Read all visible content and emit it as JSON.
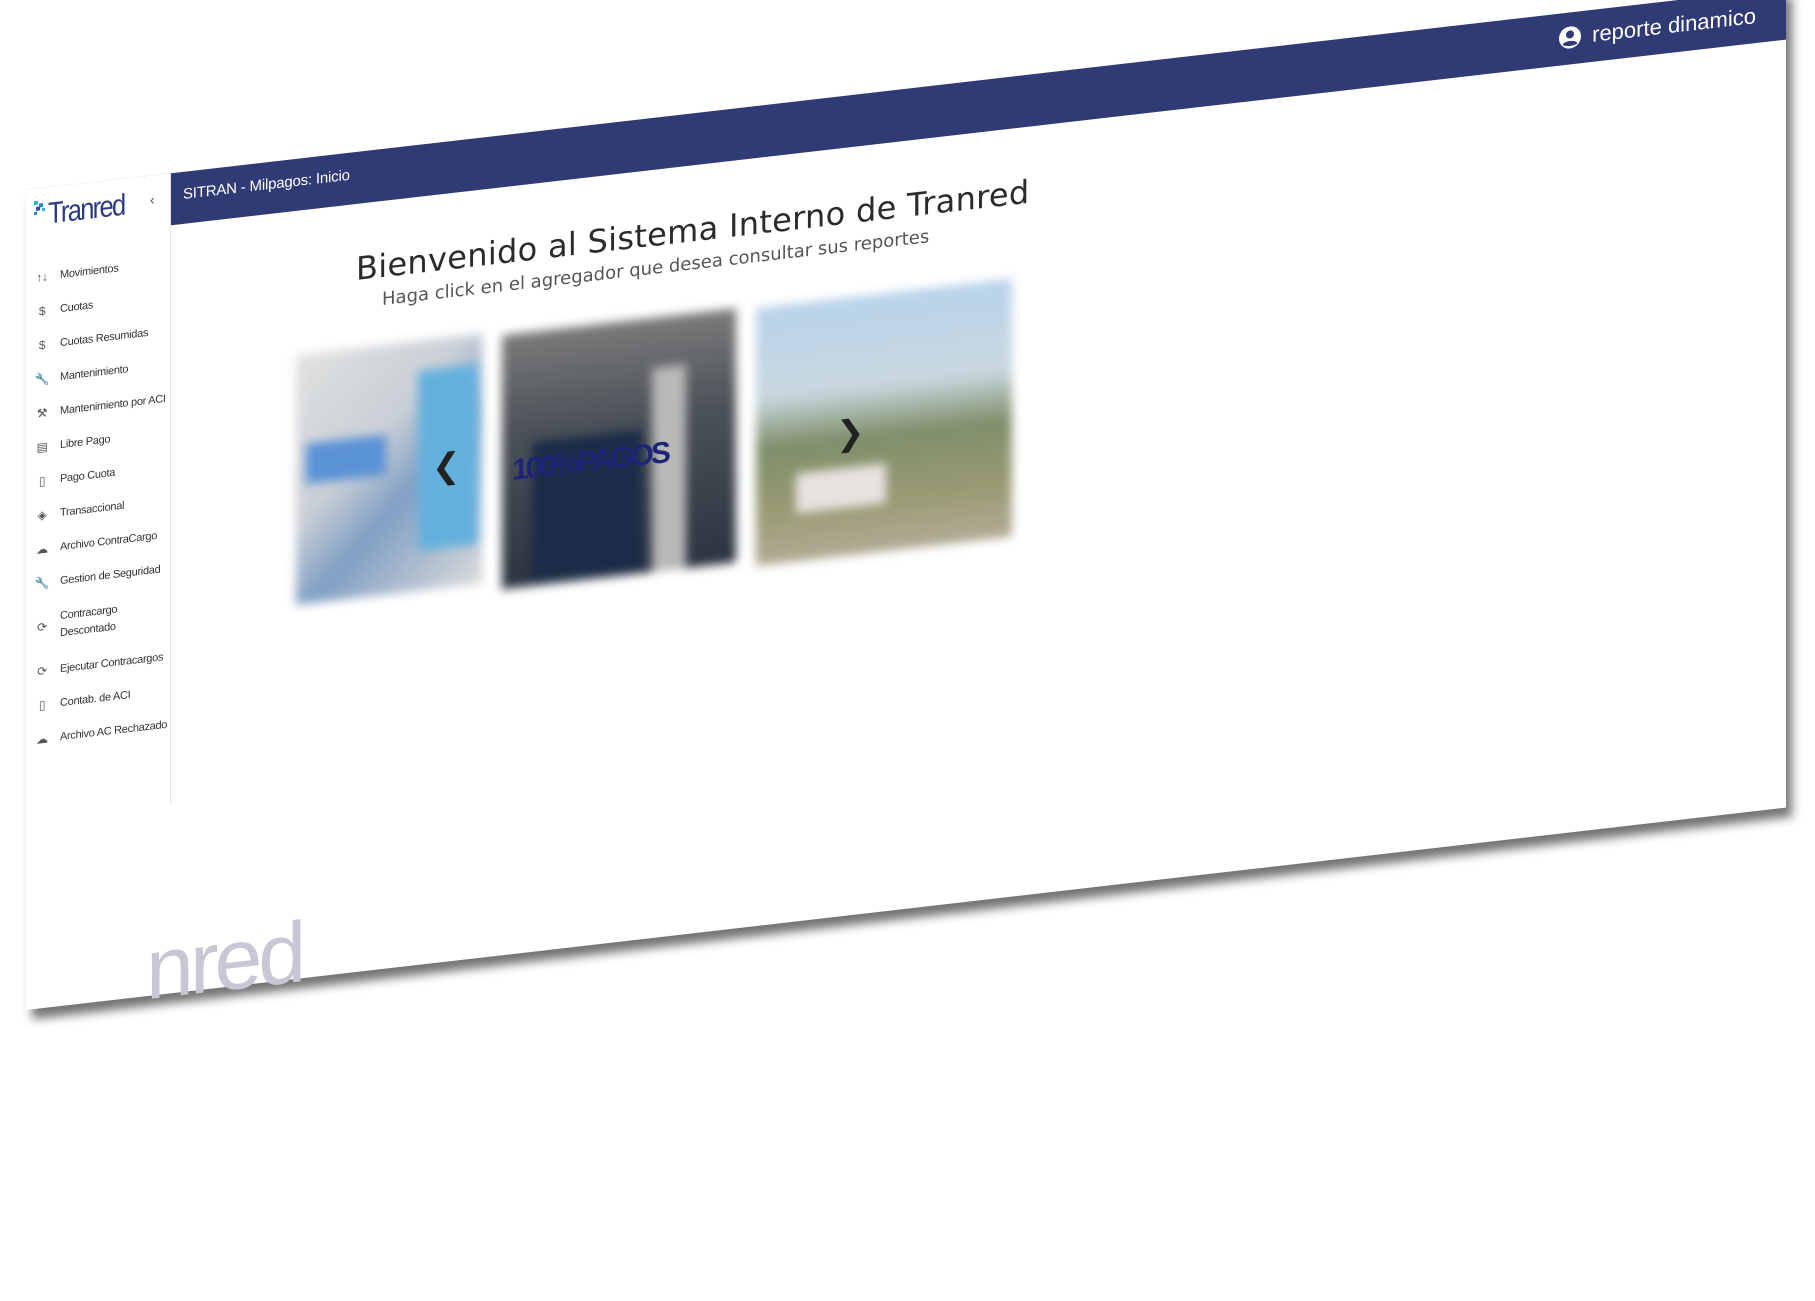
{
  "header": {
    "page_title": "SITRAN - Milpagos: Inicio",
    "user_label": "reporte dinamico",
    "bg_color": "#303a75"
  },
  "sidebar": {
    "logo_text": "Tranred",
    "collapse_icon": "‹",
    "items": [
      {
        "label": "Movimientos",
        "icon": "↑↓"
      },
      {
        "label": "Cuotas",
        "icon": "$"
      },
      {
        "label": "Cuotas Resumidas",
        "icon": "$"
      },
      {
        "label": "Mantenimiento",
        "icon": "🔧"
      },
      {
        "label": "Mantenimiento por ACI",
        "icon": "⚒"
      },
      {
        "label": "Libre Pago",
        "icon": "▤"
      },
      {
        "label": "Pago Cuota",
        "icon": "▯"
      },
      {
        "label": "Transaccional",
        "icon": "◈"
      },
      {
        "label": "Archivo ContraCargo",
        "icon": "☁"
      },
      {
        "label": "Gestion de Seguridad",
        "icon": "🔧"
      },
      {
        "label": "Contracargo Descontado",
        "icon": "⟳"
      },
      {
        "label": "Ejecutar Contracargos",
        "icon": "⟳"
      },
      {
        "label": "Contab. de ACI",
        "icon": "▯"
      },
      {
        "label": "Archivo AC Rechazado",
        "icon": "☁"
      }
    ]
  },
  "main": {
    "welcome_title": "Bienvenido al Sistema Interno de Tranred",
    "welcome_subtitle": "Haga click en el agregador que desea consultar sus reportes",
    "carousel": {
      "prev": "❮",
      "next": "❯",
      "slides": [
        "librepago",
        "100%PAGOS",
        "tranred-van"
      ],
      "center_brand": "100%PAGOS"
    },
    "watermark": "nred"
  }
}
